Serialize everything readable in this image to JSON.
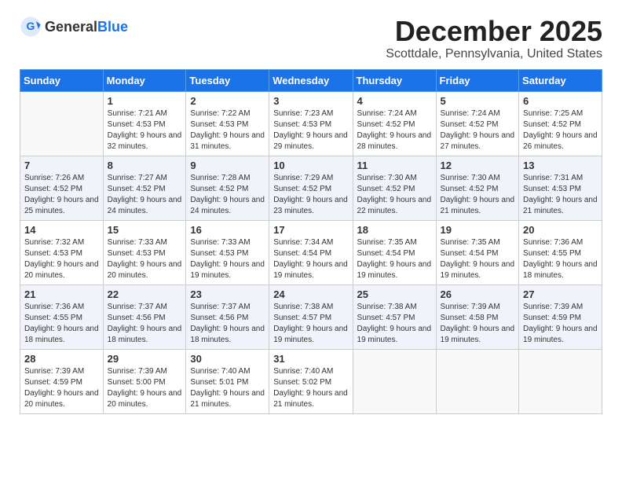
{
  "logo": {
    "general": "General",
    "blue": "Blue"
  },
  "title": "December 2025",
  "location": "Scottdale, Pennsylvania, United States",
  "weekdays": [
    "Sunday",
    "Monday",
    "Tuesday",
    "Wednesday",
    "Thursday",
    "Friday",
    "Saturday"
  ],
  "weeks": [
    [
      {
        "day": "",
        "sunrise": "",
        "sunset": "",
        "daylight": ""
      },
      {
        "day": "1",
        "sunrise": "Sunrise: 7:21 AM",
        "sunset": "Sunset: 4:53 PM",
        "daylight": "Daylight: 9 hours and 32 minutes."
      },
      {
        "day": "2",
        "sunrise": "Sunrise: 7:22 AM",
        "sunset": "Sunset: 4:53 PM",
        "daylight": "Daylight: 9 hours and 31 minutes."
      },
      {
        "day": "3",
        "sunrise": "Sunrise: 7:23 AM",
        "sunset": "Sunset: 4:53 PM",
        "daylight": "Daylight: 9 hours and 29 minutes."
      },
      {
        "day": "4",
        "sunrise": "Sunrise: 7:24 AM",
        "sunset": "Sunset: 4:52 PM",
        "daylight": "Daylight: 9 hours and 28 minutes."
      },
      {
        "day": "5",
        "sunrise": "Sunrise: 7:24 AM",
        "sunset": "Sunset: 4:52 PM",
        "daylight": "Daylight: 9 hours and 27 minutes."
      },
      {
        "day": "6",
        "sunrise": "Sunrise: 7:25 AM",
        "sunset": "Sunset: 4:52 PM",
        "daylight": "Daylight: 9 hours and 26 minutes."
      }
    ],
    [
      {
        "day": "7",
        "sunrise": "Sunrise: 7:26 AM",
        "sunset": "Sunset: 4:52 PM",
        "daylight": "Daylight: 9 hours and 25 minutes."
      },
      {
        "day": "8",
        "sunrise": "Sunrise: 7:27 AM",
        "sunset": "Sunset: 4:52 PM",
        "daylight": "Daylight: 9 hours and 24 minutes."
      },
      {
        "day": "9",
        "sunrise": "Sunrise: 7:28 AM",
        "sunset": "Sunset: 4:52 PM",
        "daylight": "Daylight: 9 hours and 24 minutes."
      },
      {
        "day": "10",
        "sunrise": "Sunrise: 7:29 AM",
        "sunset": "Sunset: 4:52 PM",
        "daylight": "Daylight: 9 hours and 23 minutes."
      },
      {
        "day": "11",
        "sunrise": "Sunrise: 7:30 AM",
        "sunset": "Sunset: 4:52 PM",
        "daylight": "Daylight: 9 hours and 22 minutes."
      },
      {
        "day": "12",
        "sunrise": "Sunrise: 7:30 AM",
        "sunset": "Sunset: 4:52 PM",
        "daylight": "Daylight: 9 hours and 21 minutes."
      },
      {
        "day": "13",
        "sunrise": "Sunrise: 7:31 AM",
        "sunset": "Sunset: 4:53 PM",
        "daylight": "Daylight: 9 hours and 21 minutes."
      }
    ],
    [
      {
        "day": "14",
        "sunrise": "Sunrise: 7:32 AM",
        "sunset": "Sunset: 4:53 PM",
        "daylight": "Daylight: 9 hours and 20 minutes."
      },
      {
        "day": "15",
        "sunrise": "Sunrise: 7:33 AM",
        "sunset": "Sunset: 4:53 PM",
        "daylight": "Daylight: 9 hours and 20 minutes."
      },
      {
        "day": "16",
        "sunrise": "Sunrise: 7:33 AM",
        "sunset": "Sunset: 4:53 PM",
        "daylight": "Daylight: 9 hours and 19 minutes."
      },
      {
        "day": "17",
        "sunrise": "Sunrise: 7:34 AM",
        "sunset": "Sunset: 4:54 PM",
        "daylight": "Daylight: 9 hours and 19 minutes."
      },
      {
        "day": "18",
        "sunrise": "Sunrise: 7:35 AM",
        "sunset": "Sunset: 4:54 PM",
        "daylight": "Daylight: 9 hours and 19 minutes."
      },
      {
        "day": "19",
        "sunrise": "Sunrise: 7:35 AM",
        "sunset": "Sunset: 4:54 PM",
        "daylight": "Daylight: 9 hours and 19 minutes."
      },
      {
        "day": "20",
        "sunrise": "Sunrise: 7:36 AM",
        "sunset": "Sunset: 4:55 PM",
        "daylight": "Daylight: 9 hours and 18 minutes."
      }
    ],
    [
      {
        "day": "21",
        "sunrise": "Sunrise: 7:36 AM",
        "sunset": "Sunset: 4:55 PM",
        "daylight": "Daylight: 9 hours and 18 minutes."
      },
      {
        "day": "22",
        "sunrise": "Sunrise: 7:37 AM",
        "sunset": "Sunset: 4:56 PM",
        "daylight": "Daylight: 9 hours and 18 minutes."
      },
      {
        "day": "23",
        "sunrise": "Sunrise: 7:37 AM",
        "sunset": "Sunset: 4:56 PM",
        "daylight": "Daylight: 9 hours and 18 minutes."
      },
      {
        "day": "24",
        "sunrise": "Sunrise: 7:38 AM",
        "sunset": "Sunset: 4:57 PM",
        "daylight": "Daylight: 9 hours and 19 minutes."
      },
      {
        "day": "25",
        "sunrise": "Sunrise: 7:38 AM",
        "sunset": "Sunset: 4:57 PM",
        "daylight": "Daylight: 9 hours and 19 minutes."
      },
      {
        "day": "26",
        "sunrise": "Sunrise: 7:39 AM",
        "sunset": "Sunset: 4:58 PM",
        "daylight": "Daylight: 9 hours and 19 minutes."
      },
      {
        "day": "27",
        "sunrise": "Sunrise: 7:39 AM",
        "sunset": "Sunset: 4:59 PM",
        "daylight": "Daylight: 9 hours and 19 minutes."
      }
    ],
    [
      {
        "day": "28",
        "sunrise": "Sunrise: 7:39 AM",
        "sunset": "Sunset: 4:59 PM",
        "daylight": "Daylight: 9 hours and 20 minutes."
      },
      {
        "day": "29",
        "sunrise": "Sunrise: 7:39 AM",
        "sunset": "Sunset: 5:00 PM",
        "daylight": "Daylight: 9 hours and 20 minutes."
      },
      {
        "day": "30",
        "sunrise": "Sunrise: 7:40 AM",
        "sunset": "Sunset: 5:01 PM",
        "daylight": "Daylight: 9 hours and 21 minutes."
      },
      {
        "day": "31",
        "sunrise": "Sunrise: 7:40 AM",
        "sunset": "Sunset: 5:02 PM",
        "daylight": "Daylight: 9 hours and 21 minutes."
      },
      {
        "day": "",
        "sunrise": "",
        "sunset": "",
        "daylight": ""
      },
      {
        "day": "",
        "sunrise": "",
        "sunset": "",
        "daylight": ""
      },
      {
        "day": "",
        "sunrise": "",
        "sunset": "",
        "daylight": ""
      }
    ]
  ]
}
